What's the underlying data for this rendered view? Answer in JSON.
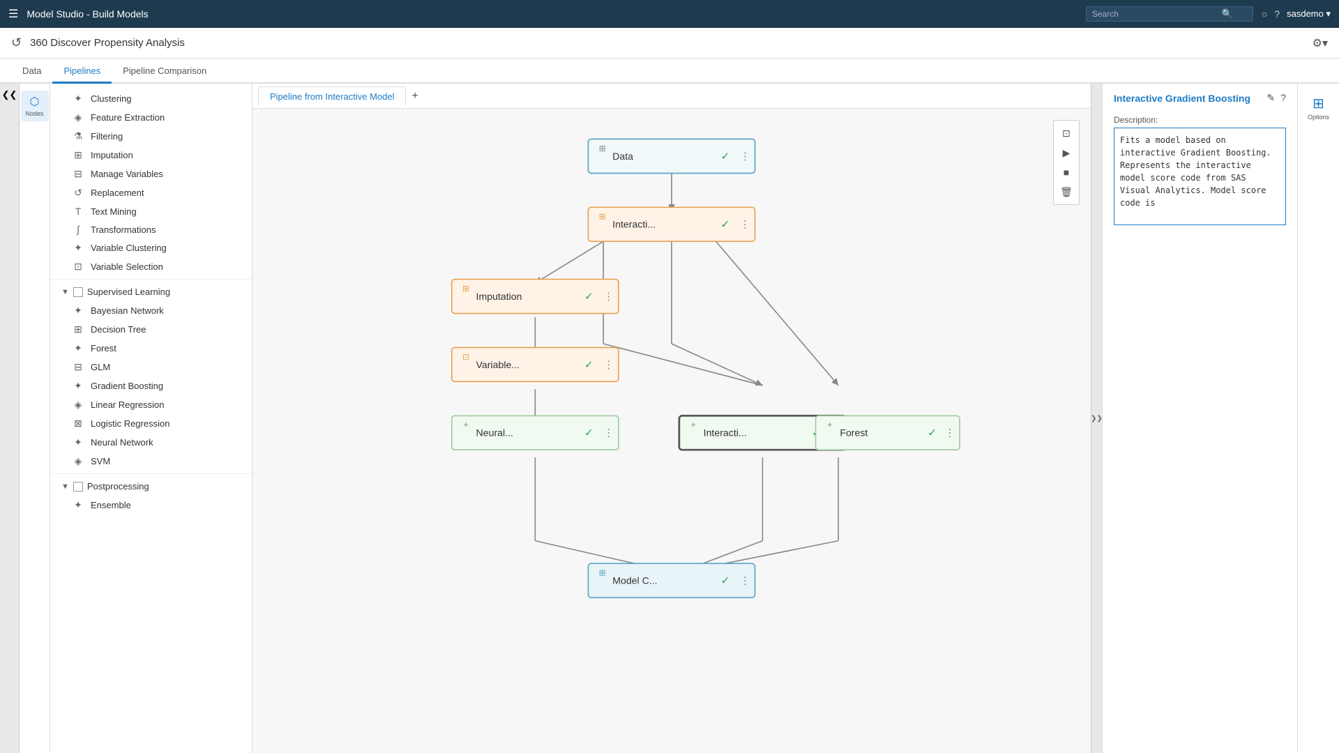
{
  "header": {
    "menu_icon": "☰",
    "title": "Model Studio - Build Models",
    "search_placeholder": "Search",
    "icons": [
      "○",
      "?"
    ],
    "user": "sasdemo ▾"
  },
  "toolbar": {
    "back_icon": "↺",
    "title": "360 Discover Propensity Analysis",
    "settings_icon": "⚙"
  },
  "tabs": [
    {
      "label": "Data",
      "active": false
    },
    {
      "label": "Pipelines",
      "active": true
    },
    {
      "label": "Pipeline Comparison",
      "active": false
    }
  ],
  "sidebar": {
    "node_panel_label": "Nodes",
    "unsupervised_items": [
      {
        "icon": "✦",
        "label": "Clustering"
      },
      {
        "icon": "◈",
        "label": "Feature Extraction"
      },
      {
        "icon": "⚗",
        "label": "Filtering"
      },
      {
        "icon": "⊞",
        "label": "Imputation"
      },
      {
        "icon": "⊟",
        "label": "Manage Variables"
      },
      {
        "icon": "↺",
        "label": "Replacement"
      },
      {
        "icon": "T",
        "label": "Text Mining"
      },
      {
        "icon": "∫",
        "label": "Transformations"
      },
      {
        "icon": "✦",
        "label": "Variable Clustering"
      },
      {
        "icon": "⊡",
        "label": "Variable Selection"
      }
    ],
    "supervised_section": "Supervised Learning",
    "supervised_items": [
      {
        "icon": "✦",
        "label": "Bayesian Network"
      },
      {
        "icon": "⊞",
        "label": "Decision Tree"
      },
      {
        "icon": "✦",
        "label": "Forest"
      },
      {
        "icon": "⊟",
        "label": "GLM"
      },
      {
        "icon": "✦",
        "label": "Gradient Boosting"
      },
      {
        "icon": "◈",
        "label": "Linear Regression"
      },
      {
        "icon": "⊠",
        "label": "Logistic Regression"
      },
      {
        "icon": "✦",
        "label": "Neural Network"
      },
      {
        "icon": "◈",
        "label": "SVM"
      }
    ],
    "postprocessing_section": "Postprocessing",
    "postprocessing_items": [
      {
        "icon": "✦",
        "label": "Ensemble"
      }
    ]
  },
  "pipeline": {
    "tab_label": "Pipeline from Interactive Model",
    "add_tab_icon": "+"
  },
  "nodes": {
    "data": {
      "label": "Data",
      "type": "data"
    },
    "interacti_top": {
      "label": "Interacti...",
      "type": "interactive"
    },
    "imputation": {
      "label": "Imputation",
      "type": "imputation"
    },
    "variable": {
      "label": "Variable...",
      "type": "variable"
    },
    "neural": {
      "label": "Neural...",
      "type": "model"
    },
    "interacti_bottom": {
      "label": "Interacti...",
      "type": "model_selected"
    },
    "forest": {
      "label": "Forest",
      "type": "model"
    },
    "model_c": {
      "label": "Model C...",
      "type": "model_compare"
    }
  },
  "right_panel": {
    "title": "Interactive Gradient Boosting",
    "edit_icon": "✎",
    "help_icon": "?",
    "options_label": "Options",
    "desc_label": "Description:",
    "description": "Fits a model based on interactive Gradient Boosting. Represents the interactive model score code from SAS Visual Analytics. Model score code is"
  },
  "canvas_toolbar": {
    "fit_icon": "⊡",
    "play_icon": "▶",
    "pause_icon": "■",
    "delete_icon": "🗑"
  }
}
